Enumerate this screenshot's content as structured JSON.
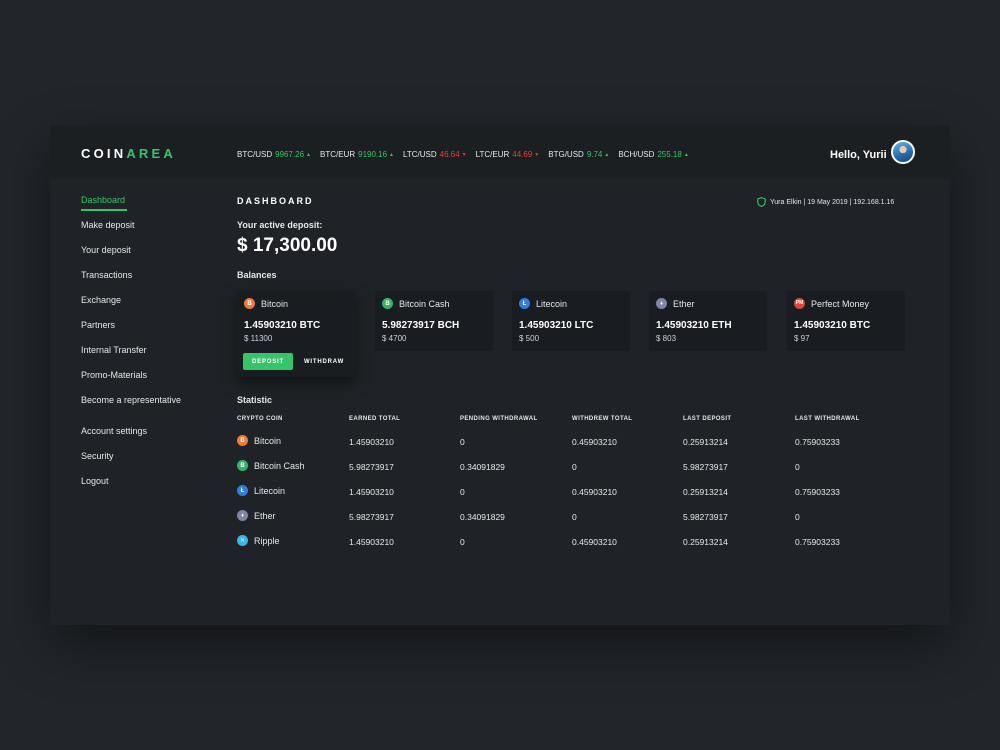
{
  "brand": {
    "part1": "COIN",
    "part2": "AREA"
  },
  "ticker": [
    {
      "pair": "BTC/USD",
      "value": "9967.26",
      "dir": "up"
    },
    {
      "pair": "BTC/EUR",
      "value": "9190.16",
      "dir": "up"
    },
    {
      "pair": "LTC/USD",
      "value": "46.64",
      "dir": "down"
    },
    {
      "pair": "LTC/EUR",
      "value": "44.69",
      "dir": "down"
    },
    {
      "pair": "BTG/USD",
      "value": "9.74",
      "dir": "up"
    },
    {
      "pair": "BCH/USD",
      "value": "255.18",
      "dir": "up"
    }
  ],
  "user": {
    "greeting": "Hello, Yurii"
  },
  "sidebar": {
    "items": [
      {
        "label": "Dashboard"
      },
      {
        "label": "Make deposit"
      },
      {
        "label": "Your deposit"
      },
      {
        "label": "Transactions"
      },
      {
        "label": "Exchange"
      },
      {
        "label": "Partners"
      },
      {
        "label": "Internal Transfer"
      },
      {
        "label": "Promo-Materials"
      },
      {
        "label": "Become a representative"
      },
      {
        "label": "Account settings"
      },
      {
        "label": "Security"
      },
      {
        "label": "Logout"
      }
    ]
  },
  "main": {
    "title": "DASHBOARD",
    "session": "Yura Elkin | 19 May 2019 | 192.168.1.16",
    "active_deposit_label": "Your active deposit:",
    "active_deposit_value": "$ 17,300.00",
    "balances_label": "Balances",
    "statistic_label": "Statistic"
  },
  "balances": [
    {
      "name": "Bitcoin",
      "amount": "1.45903210 BTC",
      "usd": "$ 11300",
      "icon": "bitcoin-icon",
      "color": "#f07a36",
      "glyph": "B"
    },
    {
      "name": "Bitcoin Cash",
      "amount": "5.98273917 BCH",
      "usd": "$ 4700",
      "icon": "bitcoin-cash-icon",
      "color": "#36b566",
      "glyph": "B"
    },
    {
      "name": "Litecoin",
      "amount": "1.45903210 LTC",
      "usd": "$ 500",
      "icon": "litecoin-icon",
      "color": "#2f7de1",
      "glyph": "Ł"
    },
    {
      "name": "Ether",
      "amount": "1.45903210 ETH",
      "usd": "$ 803",
      "icon": "ether-icon",
      "color": "#7f85a3",
      "glyph": "♦"
    },
    {
      "name": "Perfect Money",
      "amount": "1.45903210 BTC",
      "usd": "$ 97",
      "icon": "perfect-money-icon",
      "color": "#e0453a",
      "glyph": "PM"
    }
  ],
  "buttons": {
    "deposit": "DEPOSIT",
    "withdraw": "WITHDRAW"
  },
  "table": {
    "headers": [
      "CRYPTO COIN",
      "EARNED TOTAL",
      "PENDING WITHDRAWAL",
      "WITHDREW TOTAL",
      "LAST DEPOSIT",
      "LAST WITHDRAWAL"
    ],
    "rows": [
      {
        "coin": "Bitcoin",
        "icon": "bitcoin-icon",
        "color": "#f07a36",
        "glyph": "B",
        "earned": "1.45903210",
        "pending": "0",
        "withdrew": "0.45903210",
        "last_deposit": "0.25913214",
        "last_withdrawal": "0.75903233"
      },
      {
        "coin": "Bitcoin Cash",
        "icon": "bitcoin-cash-icon",
        "color": "#36b566",
        "glyph": "B",
        "earned": "5.98273917",
        "pending": "0.34091829",
        "withdrew": "0",
        "last_deposit": "5.98273917",
        "last_withdrawal": "0"
      },
      {
        "coin": "Litecoin",
        "icon": "litecoin-icon",
        "color": "#2f7de1",
        "glyph": "Ł",
        "earned": "1.45903210",
        "pending": "0",
        "withdrew": "0.45903210",
        "last_deposit": "0.25913214",
        "last_withdrawal": "0.75903233"
      },
      {
        "coin": "Ether",
        "icon": "ether-icon",
        "color": "#7f85a3",
        "glyph": "♦",
        "earned": "5.98273917",
        "pending": "0.34091829",
        "withdrew": "0",
        "last_deposit": "5.98273917",
        "last_withdrawal": "0"
      },
      {
        "coin": "Ripple",
        "icon": "ripple-icon",
        "color": "#38b6e6",
        "glyph": "✕",
        "earned": "1.45903210",
        "pending": "0",
        "withdrew": "0.45903210",
        "last_deposit": "0.25913214",
        "last_withdrawal": "0.75903233"
      }
    ]
  },
  "colors": {
    "accent": "#36c46b",
    "down": "#ea3d3d",
    "background": "#1f2327"
  }
}
